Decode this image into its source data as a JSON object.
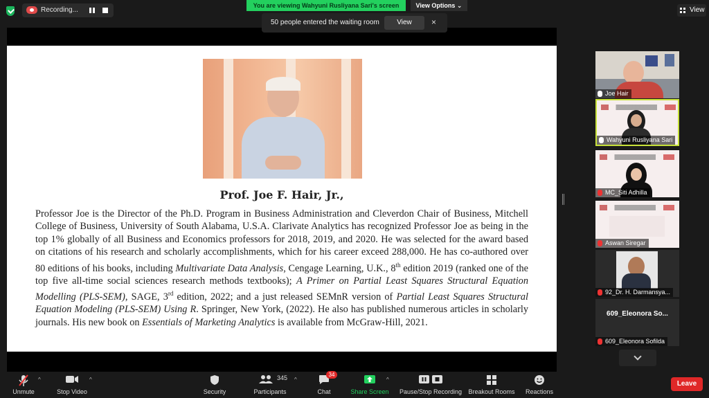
{
  "top": {
    "recording_label": "Recording...",
    "viewing_banner": "You are viewing Wahyuni Rusliyana Sari's screen",
    "view_options": "View Options",
    "waiting_room_text": "50 people entered the waiting room",
    "waiting_view_btn": "View",
    "waiting_close": "×",
    "view_btn": "View"
  },
  "slide": {
    "title": "Prof. Joe F. Hair, Jr.,",
    "p1": "Professor Joe is the Director of the Ph.D. Program in Business Administration and Cleverdon Chair of Business, Mitchell College of Business, University of South Alabama, U.S.A. Clarivate Analytics has recognized Professor Joe as being in the top 1% globally of all Business and Economics professors for 2018, 2019, and 2020. He was selected for the award based on citations of his research and scholarly accomplishments, which for his career exceed 288,000. He has co-authored over 80 editions of his books, including ",
    "book1": "Multivariate Data Analysis",
    "p2": ", Cengage Learning, U.K., 8",
    "sup1": "th",
    "p3": " edition 2019 (ranked one of the top five all-time social sciences research methods textbooks); ",
    "book2": "A Primer on Partial Least Squares Structural Equation Modelling (PLS-SEM)",
    "p4": ", SAGE, 3",
    "sup2": "rd",
    "p5": " edition, 2022; and a just released SEMnR version of ",
    "book3": "Partial Least Squares Structural Equation Modeling (PLS-SEM) Using R",
    "p6": ". Springer, New York, (2022). He also has published numerous articles in scholarly journals. His new book on ",
    "book4": "Essentials of Marketing Analytics",
    "p7": " is available from McGraw-Hill, 2021."
  },
  "participants": [
    {
      "name": "Joe Hair",
      "muted": false
    },
    {
      "name": "Wahyuni Rusliyana Sari",
      "muted": false
    },
    {
      "name": "MC_Siti Adhilla",
      "muted": true
    },
    {
      "name": "Aswan Siregar",
      "muted": true
    },
    {
      "name": "92_Dr. H. Darmansya...",
      "muted": true
    },
    {
      "name": "609_Eleonora Sofilda",
      "muted": true,
      "tile_text": "609_Eleonora So..."
    }
  ],
  "toolbar": {
    "unmute": "Unmute",
    "stop_video": "Stop Video",
    "security": "Security",
    "participants": "Participants",
    "participants_count": "345",
    "chat": "Chat",
    "chat_badge": "34",
    "share_screen": "Share Screen",
    "pause_stop_recording": "Pause/Stop Recording",
    "breakout_rooms": "Breakout Rooms",
    "reactions": "Reactions",
    "leave": "Leave"
  },
  "colors": {
    "green_banner": "#23d05e",
    "active_border": "#c8e23a",
    "leave_red": "#e02828"
  }
}
